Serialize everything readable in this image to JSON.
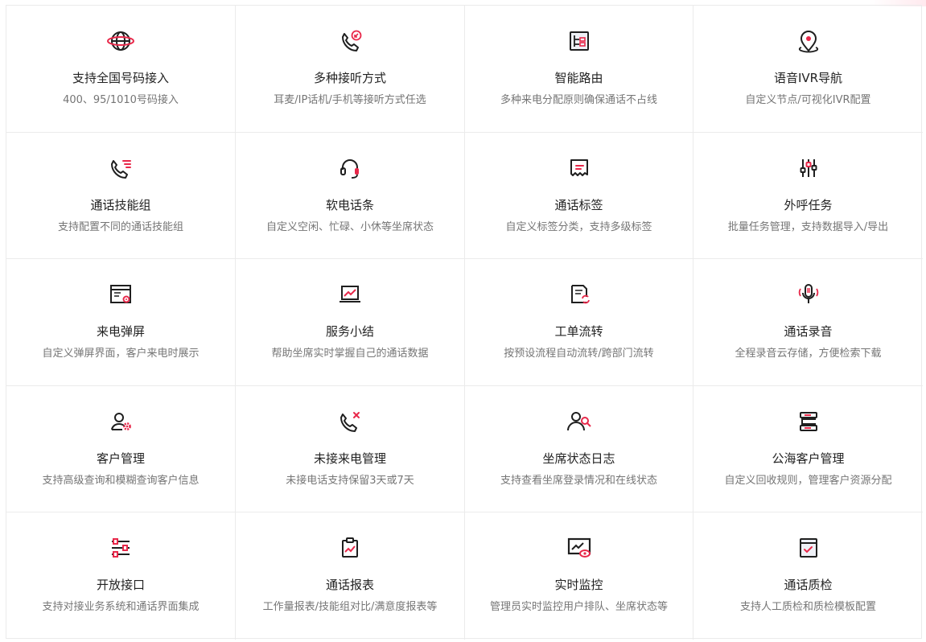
{
  "colors": {
    "accent": "#e8284a",
    "icon_dark": "#1f1f1f",
    "title": "#222222",
    "desc": "#757575",
    "border": "#ebebeb"
  },
  "features": [
    {
      "title": "支持全国号码接入",
      "desc": "400、95/1010号码接入",
      "icon": "globe-icon"
    },
    {
      "title": "多种接听方式",
      "desc": "耳麦/IP话机/手机等接听方式任选",
      "icon": "phone-incoming-icon"
    },
    {
      "title": "智能路由",
      "desc": "多种来电分配原则确保通话不占线",
      "icon": "routing-icon"
    },
    {
      "title": "语音IVR导航",
      "desc": "自定义节点/可视化IVR配置",
      "icon": "map-pin-icon"
    },
    {
      "title": "通话技能组",
      "desc": "支持配置不同的通话技能组",
      "icon": "phone-list-icon"
    },
    {
      "title": "软电话条",
      "desc": "自定义空闲、忙碌、小休等坐席状态",
      "icon": "headset-icon"
    },
    {
      "title": "通话标签",
      "desc": "自定义标签分类，支持多级标签",
      "icon": "tag-icon"
    },
    {
      "title": "外呼任务",
      "desc": "批量任务管理，支持数据导入/导出",
      "icon": "sliders-icon"
    },
    {
      "title": "来电弹屏",
      "desc": "自定义弹屏界面，客户来电时展示",
      "icon": "popup-window-icon"
    },
    {
      "title": "服务小结",
      "desc": "帮助坐席实时掌握自己的通话数据",
      "icon": "laptop-chart-icon"
    },
    {
      "title": "工单流转",
      "desc": "按预设流程自动流转/跨部门流转",
      "icon": "workorder-refresh-icon"
    },
    {
      "title": "通话录音",
      "desc": "全程录音云存储，方便检索下载",
      "icon": "microphone-icon"
    },
    {
      "title": "客户管理",
      "desc": "支持高级查询和模糊查询客户信息",
      "icon": "user-gear-icon"
    },
    {
      "title": "未接来电管理",
      "desc": "未接电话支持保留3天或7天",
      "icon": "phone-missed-icon"
    },
    {
      "title": "坐席状态日志",
      "desc": "支持查看坐席登录情况和在线状态",
      "icon": "users-search-icon"
    },
    {
      "title": "公海客户管理",
      "desc": "自定义回收规则，管理客户资源分配",
      "icon": "pool-flow-icon"
    },
    {
      "title": "开放接口",
      "desc": "支持对接业务系统和通话界面集成",
      "icon": "api-sliders-icon"
    },
    {
      "title": "通话报表",
      "desc": "工作量报表/技能组对比/满意度报表等",
      "icon": "clipboard-chart-icon"
    },
    {
      "title": "实时监控",
      "desc": "管理员实时监控用户排队、坐席状态等",
      "icon": "monitor-eye-icon"
    },
    {
      "title": "通话质检",
      "desc": "支持人工质检和质检模板配置",
      "icon": "quality-check-icon"
    }
  ]
}
